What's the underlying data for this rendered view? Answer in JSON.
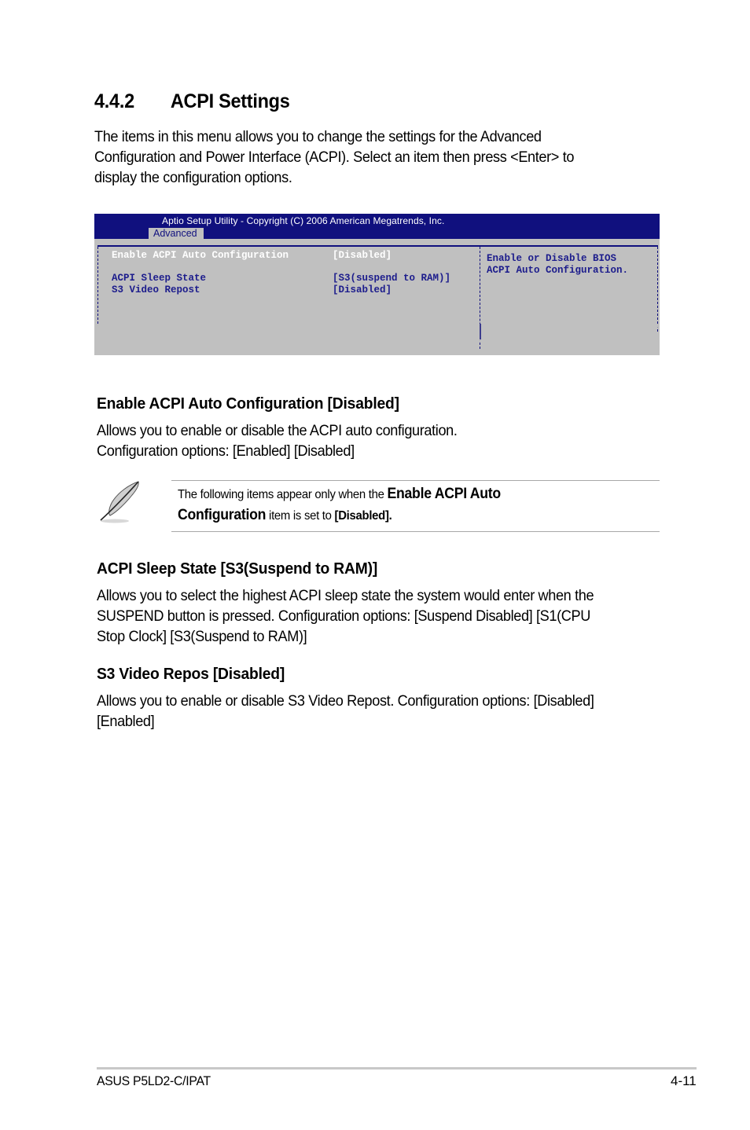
{
  "section": {
    "number": "4.4.2",
    "title": "ACPI Settings",
    "intro_lines": [
      "The items in this menu allows you to change the settings for the Advanced",
      "Configuration and Power Interface (ACPI). Select an item then press <Enter> to",
      "display the configuration options."
    ]
  },
  "bios_screen": {
    "header_title": "Aptio Setup Utility - Copyright (C) 2006 American Megatrends, Inc.",
    "active_tab": "Advanced",
    "colors": {
      "header_bg": "#10107e",
      "body_bg": "#c0c0c0",
      "text": "#1c1c8c",
      "selected_text": "#ffffff"
    },
    "items": [
      {
        "label": "Enable ACPI Auto Configuration",
        "value": "[Disabled]",
        "selected": true
      },
      {
        "label": "ACPI Sleep State",
        "value": "[S3(suspend to RAM)]",
        "selected": false
      },
      {
        "label": "S3 Video Repost",
        "value": "[Disabled]",
        "selected": false
      }
    ],
    "help_lines": [
      "Enable or Disable BIOS",
      "ACPI Auto Configuration."
    ]
  },
  "items": [
    {
      "heading": "Enable ACPI Auto Configuration [Disabled]",
      "lines": [
        "Allows you to enable or disable the ACPI auto configuration.",
        "Configuration options: [Enabled] [Disabled]"
      ]
    },
    {
      "heading": "ACPI Sleep State [S3(Suspend to RAM)]",
      "lines": [
        "Allows you to select the highest ACPI sleep state the system would enter when the",
        "SUSPEND button is pressed.  Configuration options: [Suspend Disabled] [S1(CPU",
        "Stop Clock] [S3(Suspend to RAM)]"
      ]
    },
    {
      "heading": "S3 Video Repos [Disabled]",
      "lines": [
        "Allows you to enable or disable S3 Video Repost. Configuration options: [Disabled]",
        "[Enabled]"
      ]
    }
  ],
  "note": {
    "icon": "feather-pen-icon",
    "part1": "The following items appear only when the ",
    "bold1": "Enable ACPI Auto",
    "bold2": "Configuration",
    "part2": " item is set to ",
    "bold3": "[Disabled]."
  },
  "footer": {
    "product": "ASUS P5LD2-C/IPAT",
    "page": "4-11"
  }
}
